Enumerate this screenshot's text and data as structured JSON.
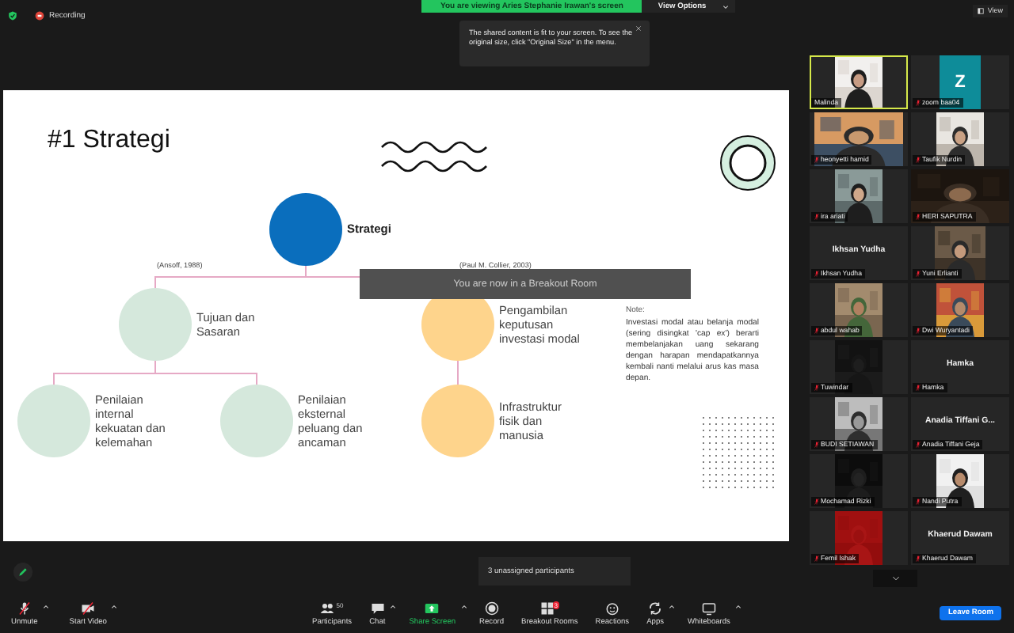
{
  "top_bar": {
    "recording": "Recording",
    "share_banner": "You are viewing Aries Stephanie Irawan's screen",
    "view_options": "View Options",
    "view_button": "View"
  },
  "share_tooltip": "The shared content is fit to your screen. To see the original size, click \"Original Size\" in the menu.",
  "slide": {
    "title": "#1 Strategi",
    "root": "Strategi",
    "branches": [
      {
        "citation": "(Ansoff, 1988)",
        "label": "Tujuan dan Sasaran",
        "color": "#d5e8dc",
        "children": [
          {
            "label": "Penilaian internal kekuatan dan kelemahan"
          },
          {
            "label": "Penilaian eksternal peluang dan ancaman"
          }
        ]
      },
      {
        "citation": "(Paul M. Collier, 2003)",
        "label": "Pengambilan keputusan investasi modal",
        "color": "#fed48c",
        "children": [
          {
            "label": "Infrastruktur fisik dan manusia"
          }
        ]
      }
    ],
    "note_heading": "Note:",
    "note": "Investasi modal atau belanja modal (sering disingkat 'cap ex') berarti membelanjakan uang sekarang dengan harapan mendapatkannya kembali nanti melalui arus kas masa depan."
  },
  "breakout_toast": "You are now in a Breakout Room",
  "participants": [
    {
      "name": "Malinda",
      "kind": "picture",
      "muted": false,
      "speaking": true
    },
    {
      "name": "zoom baa04",
      "kind": "avatar",
      "initial": "Z",
      "muted": true,
      "speaking": false
    },
    {
      "name": "heonyetti hamid",
      "kind": "picture",
      "muted": true,
      "speaking": false
    },
    {
      "name": "Taufik Nurdin",
      "kind": "picture",
      "muted": true,
      "speaking": false
    },
    {
      "name": "ira ariati",
      "kind": "picture",
      "muted": true,
      "speaking": false
    },
    {
      "name": "HERI SAPUTRA",
      "kind": "picture",
      "muted": true,
      "speaking": false
    },
    {
      "name": "Ikhsan Yudha",
      "kind": "name",
      "display": "Ikhsan Yudha",
      "muted": true,
      "speaking": false
    },
    {
      "name": "Yuni Erlianti",
      "kind": "picture",
      "muted": true,
      "speaking": false
    },
    {
      "name": "abdul wahab",
      "kind": "picture",
      "muted": true,
      "speaking": false
    },
    {
      "name": "Dwi Wuryantadi",
      "kind": "picture",
      "muted": true,
      "speaking": false
    },
    {
      "name": "Tuwindar",
      "kind": "picture",
      "muted": true,
      "speaking": false
    },
    {
      "name": "Hamka",
      "kind": "name",
      "display": "Hamka",
      "muted": true,
      "speaking": false
    },
    {
      "name": "BUDI SETIAWAN",
      "kind": "picture",
      "muted": true,
      "speaking": false
    },
    {
      "name": "Anadia Tiffani Geja",
      "kind": "name",
      "display": "Anadia Tiffani G...",
      "muted": true,
      "speaking": false
    },
    {
      "name": "Mochamad Rizki",
      "kind": "picture",
      "muted": true,
      "speaking": false
    },
    {
      "name": "Nandi Putra",
      "kind": "picture",
      "muted": true,
      "speaking": false
    },
    {
      "name": "Femil Ishak",
      "kind": "picture",
      "muted": true,
      "speaking": false
    },
    {
      "name": "Khaerud Dawam",
      "kind": "name",
      "display": "Khaerud Dawam",
      "muted": true,
      "speaking": false
    }
  ],
  "toolbar": {
    "left": [
      {
        "kind": "mic",
        "label": "Unmute",
        "caret": true
      },
      {
        "kind": "video",
        "label": "Start Video",
        "caret": true
      }
    ],
    "center": [
      {
        "kind": "participants",
        "label": "Participants",
        "count": "50",
        "caret": false
      },
      {
        "kind": "chat",
        "label": "Chat",
        "caret": true
      },
      {
        "kind": "share",
        "label": "Share Screen",
        "caret": true
      },
      {
        "kind": "record",
        "label": "Record",
        "caret": false
      },
      {
        "kind": "breakout",
        "label": "Breakout Rooms",
        "badge": "3",
        "caret": false
      },
      {
        "kind": "reactions",
        "label": "Reactions",
        "caret": false
      },
      {
        "kind": "apps",
        "label": "Apps",
        "caret": true
      },
      {
        "kind": "whiteboard",
        "label": "Whiteboards",
        "caret": true
      }
    ],
    "leave": "Leave Room"
  },
  "breakout_tooltip": "3 unassigned participants"
}
